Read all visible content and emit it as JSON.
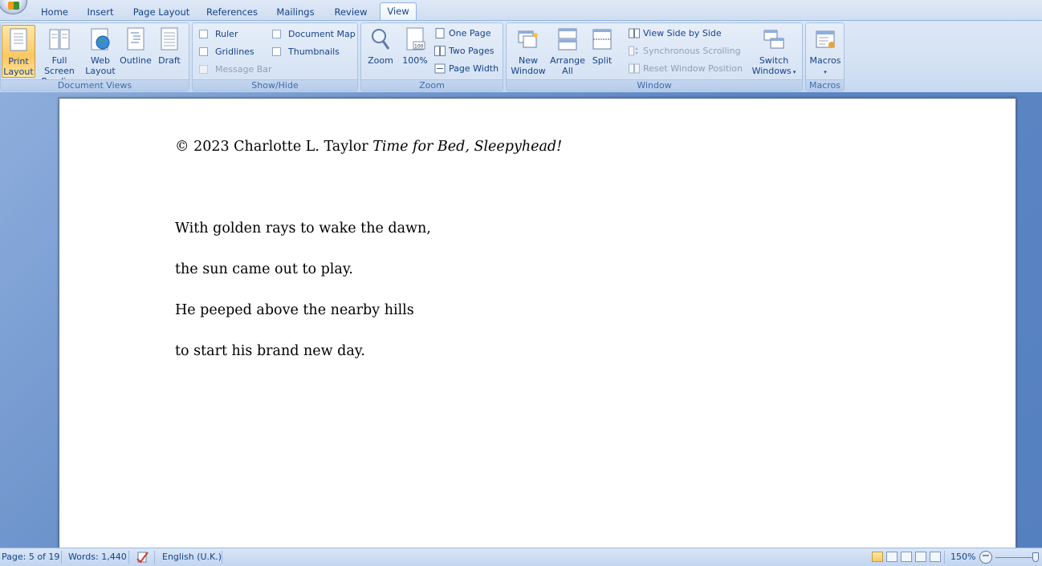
{
  "ribbon_tabs": [
    "Home",
    "Insert",
    "Page Layout",
    "References",
    "Mailings",
    "Review",
    "View"
  ],
  "active_tab": "View",
  "groups": {
    "document_views": {
      "label": "Document Views",
      "print_layout": [
        "Print",
        "Layout"
      ],
      "full_screen_reading": [
        "Full Screen",
        "Reading"
      ],
      "web_layout": [
        "Web",
        "Layout"
      ],
      "outline": "Outline",
      "draft": "Draft"
    },
    "show_hide": {
      "label": "Show/Hide",
      "ruler": "Ruler",
      "gridlines": "Gridlines",
      "message_bar": "Message Bar",
      "document_map": "Document Map",
      "thumbnails": "Thumbnails"
    },
    "zoom": {
      "label": "Zoom",
      "zoom": "Zoom",
      "percent": "100%",
      "percent_icon_text": "100",
      "one_page": "One Page",
      "two_pages": "Two Pages",
      "page_width": "Page Width"
    },
    "window": {
      "label": "Window",
      "new_window": [
        "New",
        "Window"
      ],
      "arrange_all": [
        "Arrange",
        "All"
      ],
      "split": "Split",
      "view_side_by_side": "View Side by Side",
      "synchronous_scrolling": "Synchronous Scrolling",
      "reset_window_position": "Reset Window Position",
      "switch_windows": [
        "Switch",
        "Windows"
      ]
    },
    "macros": {
      "label": "Macros",
      "macros": "Macros"
    }
  },
  "document": {
    "copyright": "© 2023 Charlotte L. Taylor",
    "title": "Time for Bed, Sleepyhead!",
    "lines": [
      "With golden rays to wake the dawn,",
      "the sun came out to play.",
      "He peeped above the nearby hills",
      "to start his brand new day."
    ]
  },
  "status": {
    "page": "Page: 5 of 19",
    "words": "Words: 1,440",
    "language": "English (U.K.)",
    "zoom": "150%"
  }
}
